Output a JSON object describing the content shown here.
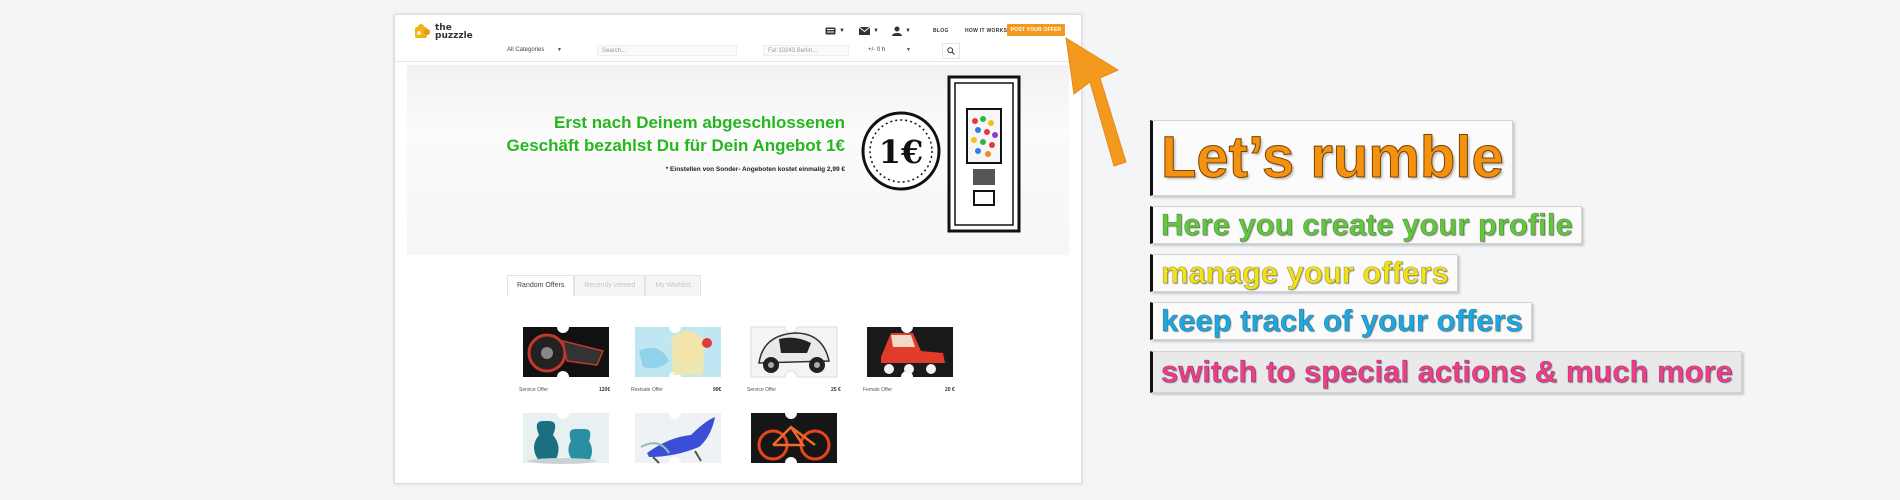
{
  "colors": {
    "accent_orange": "#f39a1e",
    "hero_green": "#26b61e",
    "profile_green": "#5fc93a",
    "offers_yellow": "#f2e21a",
    "track_blue": "#19a9e3",
    "special_pink": "#ef3c8c"
  },
  "site": {
    "logo_line1": "the",
    "logo_line2": "puzzzle",
    "nav": {
      "blog": "BLOG",
      "how_it_works": "HOW IT WORKS",
      "post_offer": "POST YOUR OFFER"
    },
    "search": {
      "category": "All Categories",
      "search_placeholder": "Search...",
      "location_placeholder": "Fa! 10243 Berlin...",
      "distance": "+/- 0 h"
    }
  },
  "hero": {
    "line1": "Erst nach Deinem abgeschlossenen",
    "line2": "Geschäft bezahlst Du für Dein Angebot 1€",
    "note": "* Einstellen von Sonder- Angeboten kostet einmalig 2,99 €",
    "coin_text": "1€"
  },
  "tabs": [
    "Random Offers",
    "Recently viewed",
    "My Wishlist"
  ],
  "offers": [
    {
      "label": "Service Offer",
      "price": "120€",
      "icon": "car-wheel-image"
    },
    {
      "label": "Restsale Offer",
      "price": "90€",
      "icon": "person-image"
    },
    {
      "label": "Service Offer",
      "price": "25 €",
      "icon": "electric-car-image"
    },
    {
      "label": "Female Offer",
      "price": "20 €",
      "icon": "roller-skate-image"
    },
    {
      "label": "",
      "price": "",
      "icon": "vases-image"
    },
    {
      "label": "",
      "price": "",
      "icon": "chair-image"
    },
    {
      "label": "",
      "price": "",
      "icon": "bicycle-image"
    }
  ],
  "callout": {
    "headline": "Let’s rumble",
    "lines": [
      "Here you create your profile",
      "manage your offers",
      "keep track of your offers",
      "switch to special actions & much more"
    ]
  }
}
